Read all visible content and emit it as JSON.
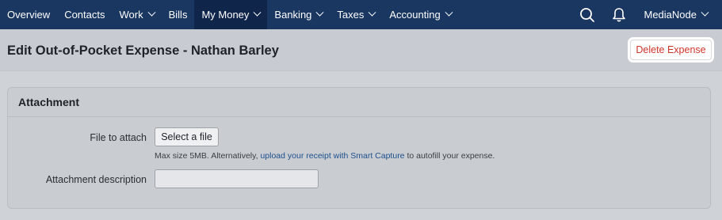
{
  "nav": {
    "items": [
      {
        "label": "Overview",
        "has_dropdown": false
      },
      {
        "label": "Contacts",
        "has_dropdown": false
      },
      {
        "label": "Work",
        "has_dropdown": true
      },
      {
        "label": "Bills",
        "has_dropdown": false
      },
      {
        "label": "My Money",
        "has_dropdown": true,
        "active": true
      },
      {
        "label": "Banking",
        "has_dropdown": true
      },
      {
        "label": "Taxes",
        "has_dropdown": true
      },
      {
        "label": "Accounting",
        "has_dropdown": true
      }
    ],
    "account_label": "MediaNode",
    "icons": [
      "search-icon",
      "bell-icon",
      "chevron-down-icon"
    ]
  },
  "page": {
    "title": "Edit Out-of-Pocket Expense - Nathan Barley",
    "delete_label": "Delete Expense"
  },
  "attachment": {
    "section_title": "Attachment",
    "file_label": "File to attach",
    "select_file_label": "Select a file",
    "hint_prefix": "Max size 5MB. Alternatively, ",
    "hint_link": "upload your receipt with Smart Capture",
    "hint_suffix": " to autofill your expense.",
    "description_label": "Attachment description",
    "description_value": ""
  },
  "colors": {
    "nav_bg": "#1a3762",
    "nav_active_bg": "#10254a",
    "delete_text": "#d0352b",
    "link": "#1d4f8c"
  }
}
